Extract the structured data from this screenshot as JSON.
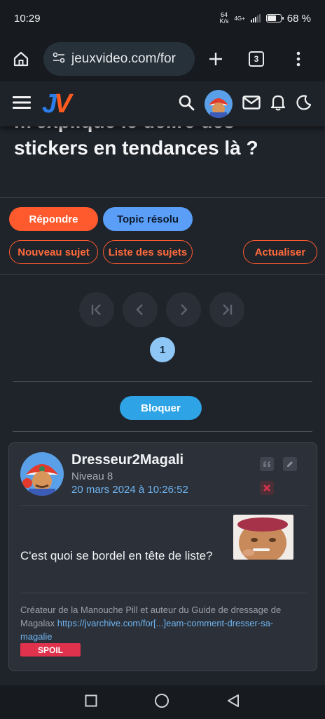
{
  "status_bar": {
    "time": "10:29",
    "net_speed_value": "64",
    "net_speed_unit": "K/s",
    "network_type": "4G+",
    "battery_level": 0.68,
    "battery_label": "68 %"
  },
  "browser": {
    "url": "jeuxvideo.com/for",
    "tab_count": "3"
  },
  "site": {
    "logo_j": "J",
    "logo_v": "V"
  },
  "topic": {
    "title_partial": "m'explique le délire des",
    "title_line2": "stickers en tendances là ?",
    "reply_label": "Répondre",
    "resolved_label": "Topic résolu",
    "new_topic_label": "Nouveau sujet",
    "topic_list_label": "Liste des sujets",
    "refresh_label": "Actualiser",
    "current_page": "1",
    "block_label": "Bloquer"
  },
  "post": {
    "author": "Dresseur2Magali",
    "level": "Niveau 8",
    "date": "20 mars 2024 à 10:26:52",
    "message": "C'est quoi se bordel en tête de liste?",
    "signature_text": "Créateur de la Manouche Pill et auteur du Guide de dressage de Magalax",
    "signature_link": "https://jvarchive.com/for[...]eam-comment-dresser-sa-magalie",
    "spoil_label": "SPOIL"
  },
  "colors": {
    "accent_orange": "#ff5a2e",
    "accent_blue": "#5a9ef8",
    "block_blue": "#2ea3e6",
    "spoil_red": "#e0314d",
    "link_blue": "#6fb4f0"
  }
}
